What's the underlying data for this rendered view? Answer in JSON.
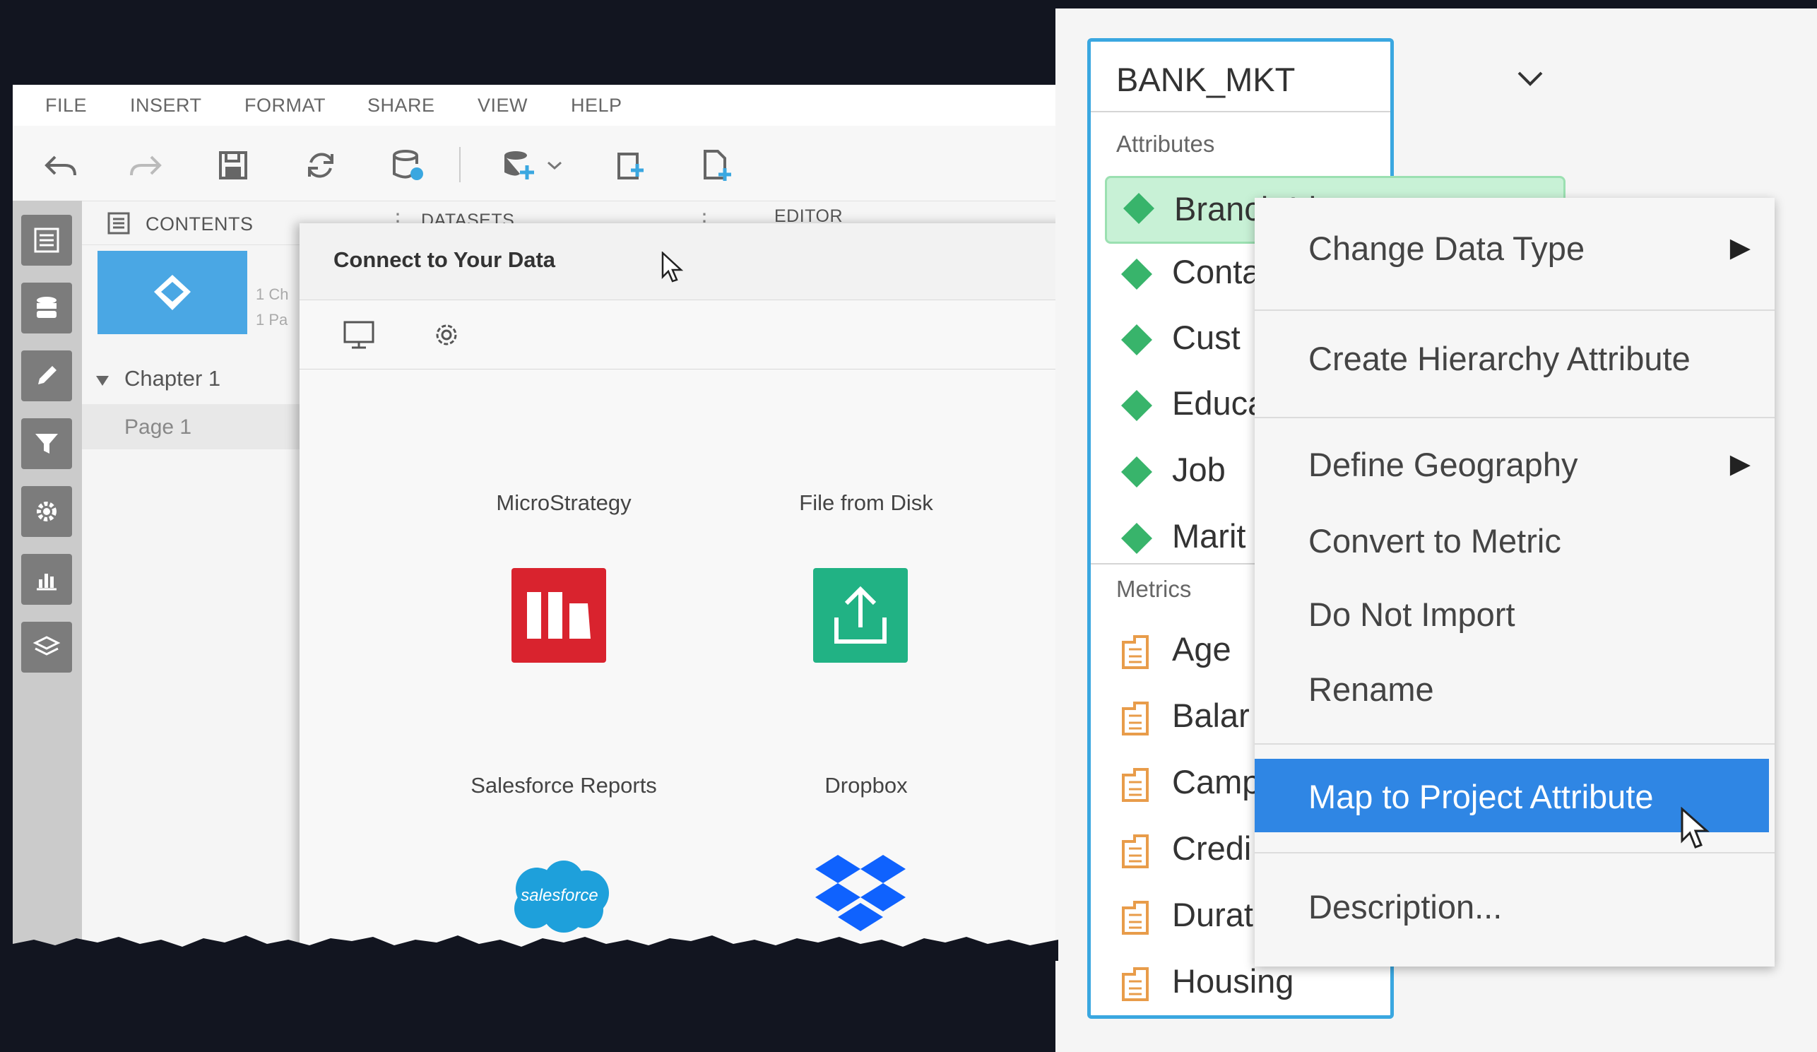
{
  "menu": [
    "FILE",
    "INSERT",
    "FORMAT",
    "SHARE",
    "VIEW",
    "HELP"
  ],
  "panels": {
    "contents": "CONTENTS",
    "datasets": "DATASETS",
    "editor": "EDITOR"
  },
  "thumb_info": [
    "1 Ch",
    "1 Pa"
  ],
  "chapter": "Chapter 1",
  "page": "Page 1",
  "dialog": {
    "title": "Connect to Your Data",
    "sources": [
      {
        "label": "MicroStrategy",
        "icon": "microstrategy-icon",
        "color": "#d9232e"
      },
      {
        "label": "File from Disk",
        "icon": "upload-icon",
        "color": "#21b284"
      },
      {
        "label": "Salesforce Reports",
        "icon": "salesforce-icon",
        "color": "#1ea0db",
        "logo_text": "salesforce"
      },
      {
        "label": "Dropbox",
        "icon": "dropbox-icon",
        "color": "#0f62fe"
      }
    ]
  },
  "dataset": {
    "title": "BANK_MKT",
    "attributes_label": "Attributes",
    "attributes": [
      "Branch Id",
      "Conta",
      "Cust",
      "Educa",
      "Job",
      "Marit"
    ],
    "metrics_label": "Metrics",
    "metrics": [
      "Age",
      "Balar",
      "Camp",
      "Credi",
      "Durat",
      "Housing"
    ]
  },
  "context_menu": [
    {
      "label": "Change Data Type",
      "submenu": "▶"
    },
    {
      "label": "Create Hierarchy Attribute"
    },
    {
      "label": "Define Geography",
      "submenu": "▶"
    },
    {
      "label": "Convert to Metric"
    },
    {
      "label": "Do Not Import"
    },
    {
      "label": "Rename"
    },
    {
      "label": "Map to Project Attribute",
      "highlighted": true
    },
    {
      "label": "Description..."
    }
  ],
  "colors": {
    "accent_blue": "#3aa7e0",
    "highlight": "#2f86e4",
    "attribute_green": "#38b46b",
    "metric_orange": "#e89c4a"
  }
}
